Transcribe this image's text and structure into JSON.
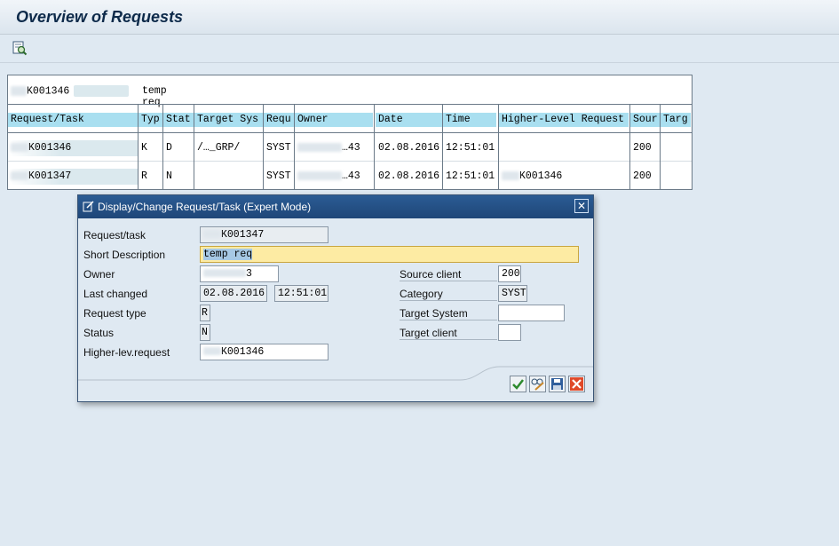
{
  "window": {
    "title": "Overview of Requests"
  },
  "toolbar": {
    "icon": "display-change-icon"
  },
  "list": {
    "top_request": "K001346",
    "top_description": "temp req",
    "columns": [
      "Request/Task",
      "Typ",
      "Stat",
      "Target Sys",
      "Requ",
      "Owner",
      "Date",
      "Time",
      "Higher-Level Request",
      "Sour",
      "Targ"
    ],
    "rows": [
      {
        "request": "K001346",
        "typ": "K",
        "stat": "D",
        "target_sys": "/…_GRP/",
        "requ": "SYST",
        "owner": "…43",
        "date": "02.08.2016",
        "time": "12:51:01",
        "higher": "",
        "sour": "200",
        "targ": ""
      },
      {
        "request": "K001347",
        "typ": "R",
        "stat": "N",
        "target_sys": "",
        "requ": "SYST",
        "owner": "…43",
        "date": "02.08.2016",
        "time": "12:51:01",
        "higher": "K001346",
        "sour": "200",
        "targ": ""
      }
    ]
  },
  "dialog": {
    "title": "Display/Change Request/Task (Expert Mode)",
    "close": "✕",
    "labels": {
      "request_task": "Request/task",
      "short_description": "Short Description",
      "owner": "Owner",
      "last_changed": "Last changed",
      "request_type": "Request type",
      "status": "Status",
      "higher_lev": "Higher-lev.request",
      "source_client": "Source client",
      "category": "Category",
      "target_system": "Target System",
      "target_client": "Target client"
    },
    "values": {
      "request_task": "K001347",
      "short_description": "temp req",
      "owner": "3",
      "last_changed_date": "02.08.2016",
      "last_changed_time": "12:51:01",
      "request_type": "R",
      "status": "N",
      "higher_lev": "K001346",
      "source_client": "200",
      "category": "SYST",
      "target_system": "",
      "target_client": ""
    },
    "buttons": [
      "confirm",
      "display-change",
      "save",
      "cancel"
    ]
  },
  "colors": {
    "title_blue": "#1f4678",
    "header_cyan": "#a9dff0",
    "edit_yellow": "#fdeba3",
    "bg": "#dfe9f2"
  }
}
